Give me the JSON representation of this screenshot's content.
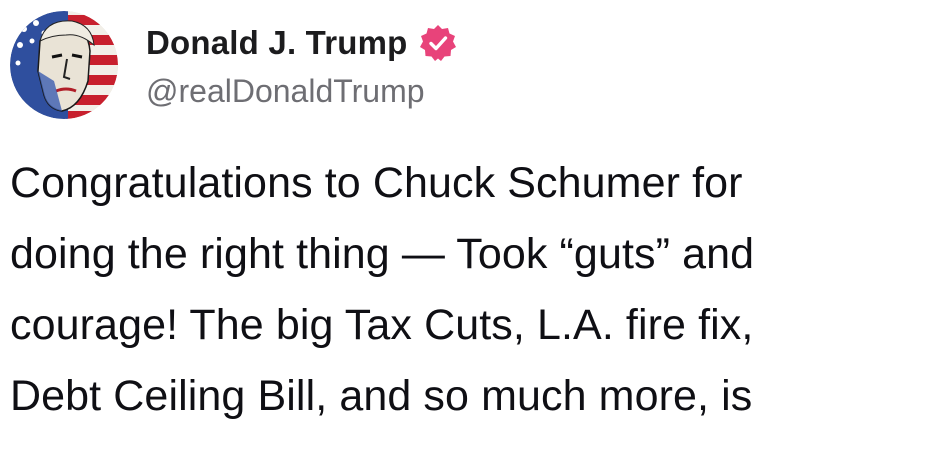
{
  "author": {
    "display_name": "Donald J. Trump",
    "handle": "@realDonaldTrump",
    "verified_badge_icon": "verified-badge-icon",
    "badge_color": "#e8437a"
  },
  "post": {
    "lines": [
      "Congratulations to Chuck Schumer for",
      "doing the right thing — Took “guts” and",
      "courage! The big Tax Cuts, L.A. fire fix,",
      "Debt Ceiling Bill, and so much more, is"
    ]
  }
}
